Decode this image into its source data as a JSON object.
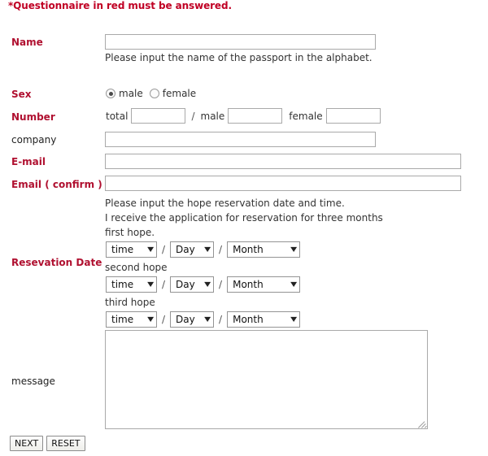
{
  "notice": "*Questionnaire in red must be answered.",
  "fields": {
    "name": {
      "label": "Name",
      "required": true,
      "value": "",
      "helper": "Please input the name of the passport in the alphabet."
    },
    "sex": {
      "label": "Sex",
      "required": true,
      "options": [
        {
          "label": "male",
          "selected": true
        },
        {
          "label": "female",
          "selected": false
        }
      ]
    },
    "number": {
      "label": "Number",
      "required": true,
      "total_label": "total",
      "total_value": "",
      "separator": "/",
      "male_label": "male",
      "male_value": "",
      "female_label": "female",
      "female_value": ""
    },
    "company": {
      "label": "company",
      "required": false,
      "value": ""
    },
    "email": {
      "label": "E-mail",
      "required": true,
      "value": ""
    },
    "email_confirm": {
      "label": "Email ( confirm )",
      "required": true,
      "value": ""
    },
    "reservation": {
      "label": "Resevation Date",
      "required": true,
      "intro_line1": "Please input the hope reservation date and time.",
      "intro_line2": "I receive the application for reservation for three months",
      "hopes": [
        {
          "caption": "first hope.",
          "time": "time",
          "day": "Day",
          "month": "Month"
        },
        {
          "caption": "second hope",
          "time": "time",
          "day": "Day",
          "month": "Month"
        },
        {
          "caption": "third hope",
          "time": "time",
          "day": "Day",
          "month": "Month"
        }
      ],
      "separator": "/"
    },
    "message": {
      "label": "message",
      "required": false,
      "value": ""
    }
  },
  "buttons": {
    "next": "NEXT",
    "reset": "RESET"
  },
  "colors": {
    "required_label": "#B01030",
    "notice": "#C00024",
    "optional_label": "#222222",
    "field_border": "#a9a9a9"
  },
  "icons": {
    "caret": "▼"
  }
}
